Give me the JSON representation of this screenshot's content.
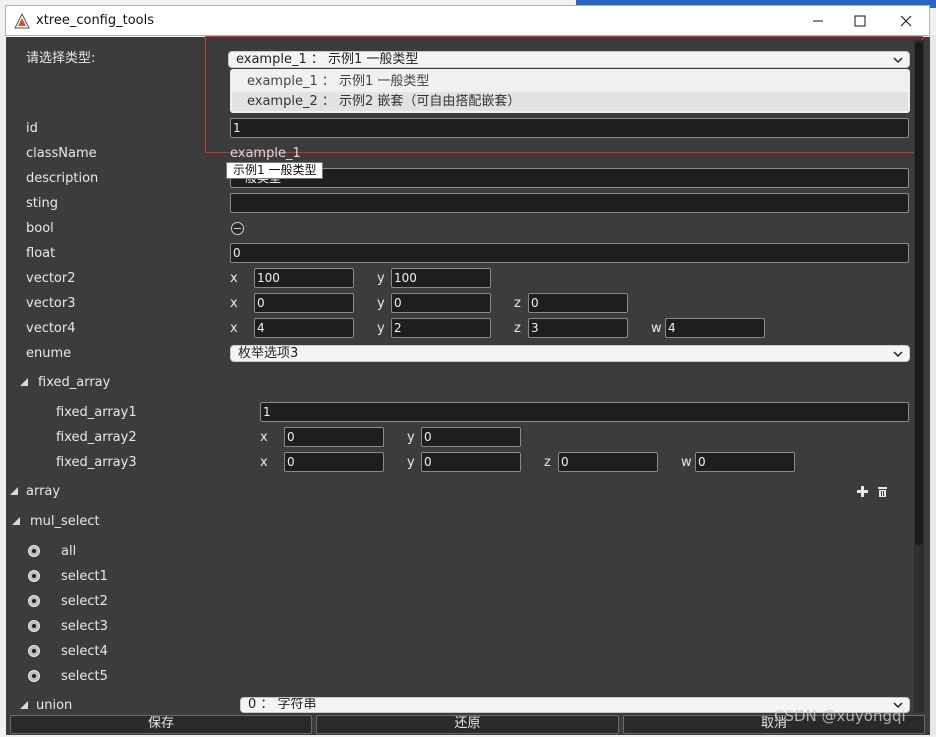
{
  "window": {
    "title": "xtree_config_tools"
  },
  "type_selector": {
    "label": "请选择类型:",
    "selected": "example_1 ： 示例1 一般类型",
    "options": [
      "example_1 ： 示例1 一般类型",
      "example_2 ： 示例2 嵌套（可自由搭配嵌套）"
    ]
  },
  "fields": {
    "id": {
      "label": "id",
      "value": "1"
    },
    "className": {
      "label": "className",
      "value": "example_1"
    },
    "description": {
      "label": "description",
      "value": "一般类型",
      "tooltip": "示例1 一般类型"
    },
    "sting": {
      "label": "sting",
      "value": ""
    },
    "bool": {
      "label": "bool"
    },
    "float": {
      "label": "float",
      "value": "0"
    },
    "vector2": {
      "label": "vector2",
      "x": "100",
      "y": "100"
    },
    "vector3": {
      "label": "vector3",
      "x": "0",
      "y": "0",
      "z": "0"
    },
    "vector4": {
      "label": "vector4",
      "x": "4",
      "y": "2",
      "z": "3",
      "w": "4"
    },
    "enume": {
      "label": "enume",
      "value": "枚举选项3"
    }
  },
  "axis_labels": {
    "x": "x",
    "y": "y",
    "z": "z",
    "w": "w"
  },
  "fixed_array": {
    "label": "fixed_array",
    "item1": {
      "label": "fixed_array1",
      "value": "1"
    },
    "item2": {
      "label": "fixed_array2",
      "x": "0",
      "y": "0"
    },
    "item3": {
      "label": "fixed_array3",
      "x": "0",
      "y": "0",
      "z": "0",
      "w": "0"
    }
  },
  "array": {
    "label": "array"
  },
  "mul_select": {
    "label": "mul_select",
    "options": [
      "all",
      "select1",
      "select2",
      "select3",
      "select4",
      "select5"
    ]
  },
  "union": {
    "label": "union",
    "value": "0 ： 字符串"
  },
  "footer": {
    "save": "保存",
    "restore": "还原",
    "cancel": "取消"
  },
  "watermark": "CSDN @xuyongqi",
  "colors": {
    "panel_bg": "#3c3c3c",
    "field_bg": "#1e1e1e",
    "highlight_border": "#d23030",
    "titlebar_bg": "#ffffff"
  }
}
